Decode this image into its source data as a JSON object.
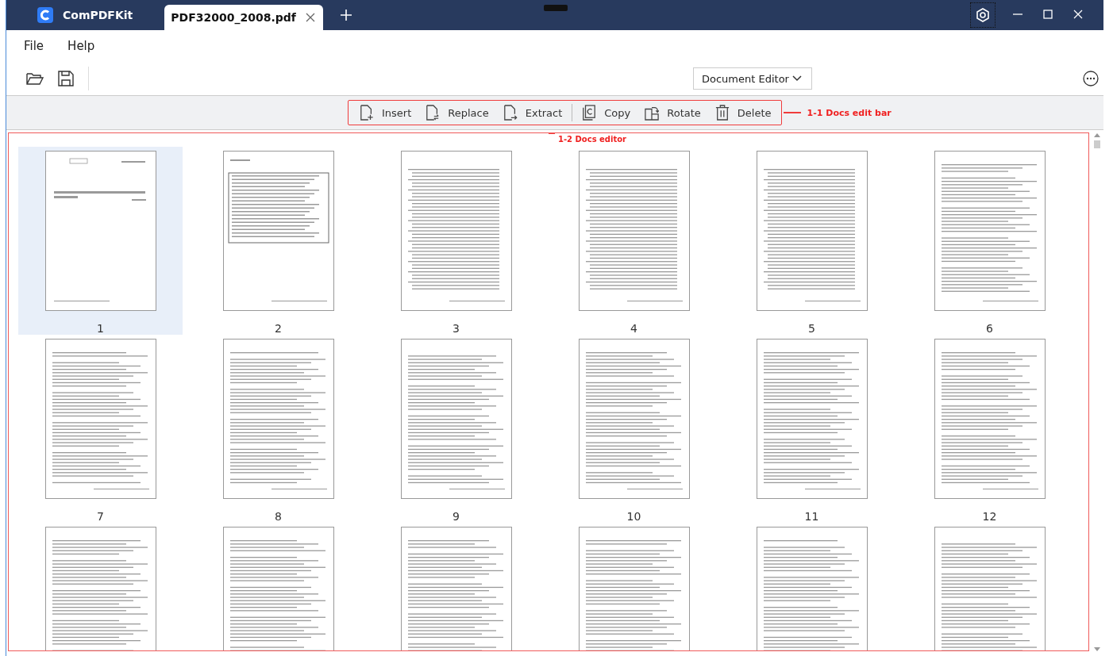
{
  "app": {
    "name": "ComPDFKit"
  },
  "tabs": [
    {
      "label": "PDF32000_2008.pdf",
      "selected": true
    }
  ],
  "menu": [
    "File",
    "Help"
  ],
  "mode_dropdown": {
    "value": "Document Editor"
  },
  "edit_bar": [
    {
      "label": "Insert",
      "kind": "insert"
    },
    {
      "label": "Replace",
      "kind": "replace"
    },
    {
      "label": "Extract",
      "kind": "extract"
    },
    {
      "label": "Copy",
      "kind": "copy"
    },
    {
      "label": "Rotate",
      "kind": "rotate"
    },
    {
      "label": "Delete",
      "kind": "delete"
    }
  ],
  "annotations": [
    {
      "label": "1-1 Docs edit bar"
    },
    {
      "label": "1-2 Docs editor"
    }
  ],
  "pages": [
    {
      "label": "1",
      "selected": true,
      "kind": "cover"
    },
    {
      "label": "2",
      "selected": false,
      "kind": "notice"
    },
    {
      "label": "3",
      "selected": false,
      "kind": "contents"
    },
    {
      "label": "4",
      "selected": false,
      "kind": "contents"
    },
    {
      "label": "5",
      "selected": false,
      "kind": "contents"
    },
    {
      "label": "6",
      "selected": false,
      "kind": "text"
    },
    {
      "label": "7",
      "selected": false,
      "kind": "text"
    },
    {
      "label": "8",
      "selected": false,
      "kind": "text"
    },
    {
      "label": "9",
      "selected": false,
      "kind": "text"
    },
    {
      "label": "10",
      "selected": false,
      "kind": "text"
    },
    {
      "label": "11",
      "selected": false,
      "kind": "text"
    },
    {
      "label": "12",
      "selected": false,
      "kind": "text"
    },
    {
      "selected": false,
      "kind": "text"
    },
    {
      "selected": false,
      "kind": "text"
    },
    {
      "selected": false,
      "kind": "text"
    },
    {
      "selected": false,
      "kind": "text"
    },
    {
      "selected": false,
      "kind": "text"
    },
    {
      "selected": false,
      "kind": "text"
    }
  ]
}
